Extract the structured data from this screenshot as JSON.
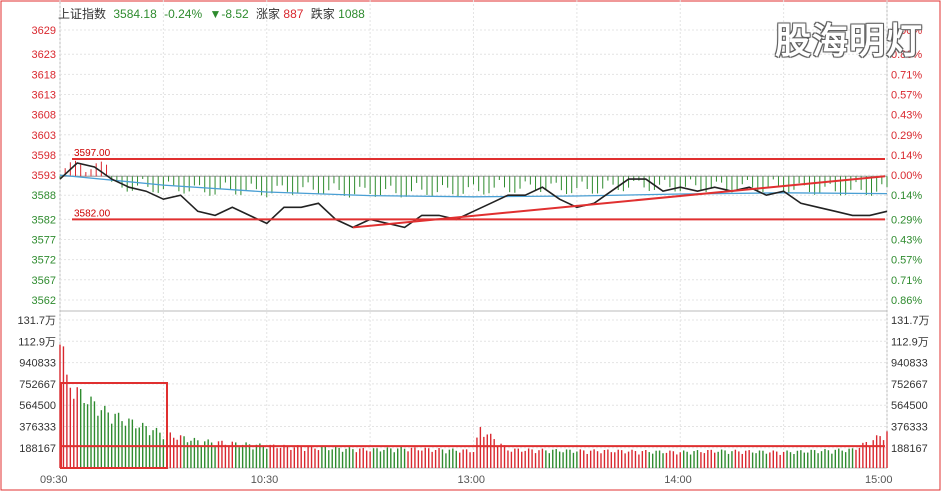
{
  "header": {
    "index_name": "上证指数",
    "price": "3584.18",
    "change_pct": "-0.24%",
    "change_pts": "▼-8.52",
    "up_label": "涨家",
    "up_count": "887",
    "down_label": "跌家",
    "down_count": "1088"
  },
  "watermark": "股海明灯",
  "colors": {
    "up": "#d9272e",
    "down": "#2e8b2e",
    "price_line": "#222222",
    "avg_line": "#4a9fd4",
    "grid": "#e4e4e4",
    "frame": "#e03030"
  },
  "chart_data": [
    {
      "type": "line",
      "panel": "price",
      "y_ticks": [
        "3629",
        "3623",
        "3618",
        "3613",
        "3608",
        "3603",
        "3598",
        "3593",
        "3588",
        "3582",
        "3577",
        "3572",
        "3567",
        "3562"
      ],
      "y_ticks_right": [
        "1.00%",
        "0.86%",
        "0.71%",
        "0.57%",
        "0.43%",
        "0.29%",
        "0.14%",
        "0.00%",
        "0.14%",
        "0.29%",
        "0.43%",
        "0.57%",
        "0.71%",
        "0.86%"
      ],
      "ylim": [
        3560,
        3631
      ],
      "prev_close": 3592.7,
      "x_ticks": [
        "09:30",
        "10:30",
        "13:00",
        "14:00",
        "15:00"
      ],
      "annotations": [
        {
          "text": "3597.00",
          "value": 3597.0
        },
        {
          "text": "3582.00",
          "value": 3582.0
        }
      ],
      "series": [
        {
          "role": "price",
          "x_minutes": [
            0,
            5,
            10,
            15,
            20,
            25,
            30,
            35,
            40,
            45,
            50,
            55,
            60,
            65,
            70,
            75,
            80,
            85,
            90,
            95,
            100,
            105,
            110,
            115,
            120,
            125,
            130,
            135,
            140,
            145,
            150,
            155,
            160,
            165,
            170,
            175,
            180,
            185,
            190,
            195,
            200,
            205,
            210,
            215,
            220,
            225,
            230,
            235,
            240
          ],
          "values": [
            3592,
            3596,
            3595,
            3592,
            3590,
            3589,
            3587,
            3588,
            3584,
            3583,
            3585,
            3583,
            3581,
            3585,
            3585,
            3586,
            3582,
            3580,
            3582,
            3581,
            3580,
            3583,
            3583,
            3582,
            3584,
            3586,
            3588,
            3588,
            3590,
            3587,
            3585,
            3586,
            3589,
            3592,
            3592,
            3589,
            3590,
            3589,
            3590,
            3589,
            3590,
            3588,
            3589,
            3586,
            3585,
            3584,
            3583,
            3583,
            3584
          ]
        },
        {
          "role": "average",
          "x_minutes": [
            0,
            30,
            60,
            90,
            120,
            150,
            180,
            210,
            240
          ],
          "values": [
            3593,
            3590.5,
            3588.8,
            3587.9,
            3587.6,
            3587.8,
            3588.3,
            3588.6,
            3588.4
          ]
        }
      ]
    },
    {
      "type": "bar",
      "panel": "volume",
      "y_ticks": [
        "131.7万",
        "112.9万",
        "940833",
        "752667",
        "564500",
        "376333",
        "188167"
      ],
      "ylim": [
        0,
        1317000
      ],
      "x_minutes": [
        0,
        2,
        4,
        6,
        8,
        10,
        12,
        14,
        16,
        18,
        20,
        22,
        24,
        26,
        28,
        30,
        35,
        40,
        50,
        60,
        70,
        80,
        90,
        100,
        110,
        120,
        122,
        130,
        140,
        150,
        160,
        170,
        180,
        190,
        200,
        210,
        220,
        230,
        236,
        238,
        240
      ],
      "values": [
        1250000,
        700000,
        650000,
        600000,
        560000,
        520000,
        480000,
        450000,
        430000,
        400000,
        380000,
        360000,
        340000,
        320000,
        300000,
        280000,
        250000,
        220000,
        200000,
        180000,
        170000,
        160000,
        150000,
        160000,
        150000,
        140000,
        320000,
        150000,
        145000,
        140000,
        140000,
        135000,
        130000,
        140000,
        135000,
        130000,
        140000,
        150000,
        230000,
        260000,
        290000
      ]
    }
  ]
}
